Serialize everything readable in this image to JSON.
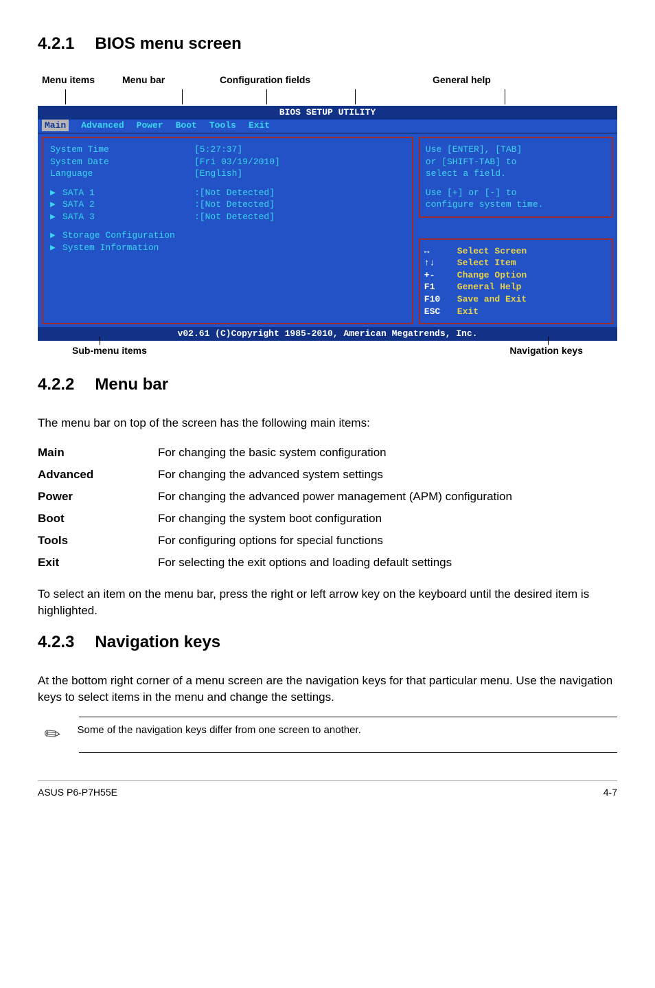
{
  "section421": {
    "num": "4.2.1",
    "title": "BIOS menu screen"
  },
  "topLabels": {
    "menuItems": "Menu items",
    "menuBar": "Menu bar",
    "configFields": "Configuration fields",
    "generalHelp": "General help"
  },
  "bios": {
    "title": "BIOS SETUP UTILITY",
    "tabs": [
      "Main",
      "Advanced",
      "Power",
      "Boot",
      "Tools",
      "Exit"
    ],
    "left": {
      "sysTimeLabel": "System Time",
      "sysTimeVal": "[5:27:37]",
      "sysDateLabel": "System Date",
      "sysDateVal": "[Fri 03/19/2010]",
      "langLabel": "Language",
      "langVal": "[English]",
      "sata1": "SATA 1",
      "sata2": "SATA 2",
      "sata3": "SATA 3",
      "notDetected": ":[Not Detected]",
      "storageCfg": "Storage Configuration",
      "sysInfo": "System Information"
    },
    "help": {
      "l1": "Use [ENTER], [TAB]",
      "l2": "or [SHIFT-TAB] to",
      "l3": "select a field.",
      "l4": "Use [+] or [-] to",
      "l5": "configure system time."
    },
    "nav": {
      "r1k": "↔",
      "r1v": "Select Screen",
      "r2k": "↑↓",
      "r2v": "Select Item",
      "r3k": "+-",
      "r3v": "Change Option",
      "r4k": "F1",
      "r4v": "General Help",
      "r5k": "F10",
      "r5v": "Save and Exit",
      "r6k": "ESC",
      "r6v": "Exit"
    },
    "copyright": "v02.61 (C)Copyright 1985-2010, American Megatrends, Inc."
  },
  "bottomLabels": {
    "sub": "Sub-menu items",
    "nav": "Navigation keys"
  },
  "section422": {
    "num": "4.2.2",
    "title": "Menu bar",
    "intro": "The menu bar on top of the screen has the following main items:",
    "rows": [
      {
        "k": "Main",
        "v": "For changing the basic system configuration"
      },
      {
        "k": "Advanced",
        "v": "For changing the advanced system settings"
      },
      {
        "k": "Power",
        "v": "For changing the advanced power management (APM) configuration"
      },
      {
        "k": "Boot",
        "v": "For changing the system boot configuration"
      },
      {
        "k": "Tools",
        "v": "For configuring options for special functions"
      },
      {
        "k": "Exit",
        "v": "For selecting the exit options and loading default settings"
      }
    ],
    "outro": "To select an item on the menu bar, press the right or left arrow key on the keyboard until the desired item is highlighted."
  },
  "section423": {
    "num": "4.2.3",
    "title": "Navigation keys",
    "para": "At the bottom right corner of a menu screen are the navigation keys for that particular menu. Use the navigation keys to select items in the menu and change the settings.",
    "note": "Some of the navigation keys differ from one screen to another."
  },
  "footer": {
    "left": "ASUS P6-P7H55E",
    "right": "4-7"
  }
}
